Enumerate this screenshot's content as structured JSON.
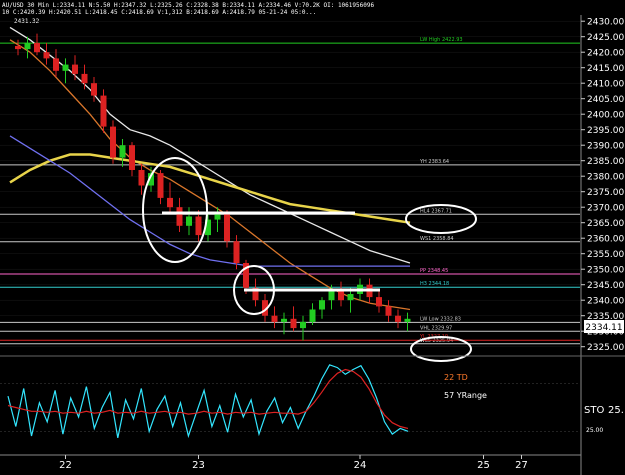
{
  "header": {
    "line1": "AU/USD 30 Min  L:2334.11  N:5.50  H:2347.32  L:2325.26  C:2328.38  B:2334.11  A:2334.46  V:70.2K  OI: 1061956096",
    "line2": "2431.32",
    "line3": "10  C:2420.39  H:2420.51  L:2418.45  C:2418.69  V:1,312  B:2418.69  A:2418.79  05-21-24  05:0..."
  },
  "colors": {
    "background": "#000000",
    "up_candle": "#22cc22",
    "down_candle": "#dd2222",
    "white_ma": "#e8e8e8",
    "yellow_ma": "#e8d44a",
    "orange_ma": "#d9762b",
    "purple_ma": "#7070f0",
    "lw_high": "#22cc22",
    "yh_line": "#c8c8c8",
    "pivot_pink": "#ff66cc",
    "r2_cyan": "#33cccc",
    "lw_low": "#c8c8c8",
    "yl_line": "#dd2222",
    "stoch_cyan": "#33e6ff",
    "stoch_red": "#dd2222",
    "axis_text": "#ffffff"
  },
  "chart_data": {
    "type": "candlestick",
    "ylim": [
      2322,
      2432
    ],
    "y_ticks": [
      2325,
      2330,
      2335,
      2340,
      2345,
      2350,
      2355,
      2360,
      2365,
      2370,
      2375,
      2380,
      2385,
      2390,
      2395,
      2400,
      2405,
      2410,
      2415,
      2420,
      2425,
      2430
    ],
    "y_tick_labels": [
      "2325.00",
      "2330.00",
      "2335.00",
      "2340.00",
      "2345.00",
      "2350.00",
      "2355.00",
      "2360.00",
      "2365.00",
      "2370.00",
      "2375.00",
      "2380.00",
      "2385.00",
      "2390.00",
      "2395.00",
      "2400.00",
      "2405.00",
      "2410.00",
      "2415.00",
      "2420.00",
      "2425.00",
      "2430.00"
    ],
    "last_price": "2334.11",
    "x_labels": [
      {
        "label": "22",
        "index": 5
      },
      {
        "label": "23",
        "index": 19
      },
      {
        "label": "24",
        "index": 36
      },
      {
        "label": "25",
        "index": 49
      },
      {
        "label": "27",
        "index": 53
      }
    ],
    "candles": [
      [
        2422,
        2424,
        2419,
        2421
      ],
      [
        2421,
        2425,
        2418,
        2423
      ],
      [
        2423,
        2426,
        2419,
        2420
      ],
      [
        2420,
        2423,
        2416,
        2418
      ],
      [
        2418,
        2421,
        2412,
        2414
      ],
      [
        2414,
        2418,
        2410,
        2416
      ],
      [
        2416,
        2419,
        2411,
        2413
      ],
      [
        2413,
        2416,
        2408,
        2410
      ],
      [
        2410,
        2412,
        2404,
        2406
      ],
      [
        2406,
        2408,
        2394,
        2396
      ],
      [
        2396,
        2398,
        2384,
        2386
      ],
      [
        2386,
        2392,
        2383,
        2390
      ],
      [
        2390,
        2391,
        2380,
        2382
      ],
      [
        2382,
        2384,
        2374,
        2377
      ],
      [
        2377,
        2383,
        2375,
        2381
      ],
      [
        2381,
        2382,
        2371,
        2373
      ],
      [
        2373,
        2378,
        2368,
        2370
      ],
      [
        2370,
        2373,
        2362,
        2364
      ],
      [
        2364,
        2370,
        2361,
        2367
      ],
      [
        2367,
        2369,
        2359,
        2361
      ],
      [
        2361,
        2368,
        2359,
        2366
      ],
      [
        2366,
        2370,
        2362,
        2368
      ],
      [
        2368,
        2369,
        2357,
        2359
      ],
      [
        2359,
        2361,
        2350,
        2352
      ],
      [
        2352,
        2353,
        2342,
        2344
      ],
      [
        2344,
        2347,
        2338,
        2340
      ],
      [
        2340,
        2342,
        2333,
        2335
      ],
      [
        2335,
        2338,
        2331,
        2333
      ],
      [
        2333,
        2336,
        2329,
        2334
      ],
      [
        2334,
        2338,
        2330,
        2331
      ],
      [
        2331,
        2335,
        2327,
        2333
      ],
      [
        2333,
        2339,
        2332,
        2337
      ],
      [
        2337,
        2341,
        2334,
        2340
      ],
      [
        2340,
        2345,
        2337,
        2343
      ],
      [
        2343,
        2346,
        2338,
        2340
      ],
      [
        2340,
        2344,
        2336,
        2342
      ],
      [
        2342,
        2347,
        2340,
        2345
      ],
      [
        2345,
        2347,
        2339,
        2341
      ],
      [
        2341,
        2343,
        2336,
        2338
      ],
      [
        2338,
        2340,
        2333,
        2335
      ],
      [
        2335,
        2337,
        2331,
        2333
      ],
      [
        2333,
        2336,
        2330,
        2334
      ]
    ],
    "moving_averages": [
      {
        "color_key": "white_ma",
        "values": [
          2428,
          2424,
          2419,
          2414,
          2408,
          2400,
          2395,
          2393,
          2390,
          2386,
          2382,
          2378,
          2374,
          2371,
          2368,
          2365,
          2362,
          2359,
          2356,
          2354,
          2352
        ]
      },
      {
        "color_key": "orange_ma",
        "values": [
          2424,
          2420,
          2414,
          2407,
          2400,
          2392,
          2386,
          2382,
          2379,
          2375,
          2371,
          2367,
          2362,
          2357,
          2352,
          2348,
          2344,
          2341,
          2339,
          2338,
          2337
        ]
      },
      {
        "color_key": "yellow_ma",
        "values": [
          2378,
          2382,
          2385,
          2387,
          2387,
          2386,
          2385,
          2384,
          2383,
          2381,
          2379,
          2377,
          2375,
          2373,
          2371,
          2370,
          2369,
          2368,
          2367,
          2366,
          2365
        ]
      },
      {
        "color_key": "purple_ma",
        "values": [
          2393,
          2389,
          2385,
          2381,
          2376,
          2371,
          2366,
          2362,
          2358,
          2355,
          2353,
          2352,
          2351,
          2351,
          2351,
          2351,
          2351,
          2351,
          2351,
          2351,
          2351
        ]
      }
    ],
    "levels": [
      {
        "label": "LW High  2422.93",
        "value": 2422.93,
        "color_key": "lw_high"
      },
      {
        "label": "YH  2383.64",
        "value": 2383.64,
        "color_key": "yh_line"
      },
      {
        "label": "HL4  2367.71",
        "value": 2367.71,
        "color_key": "yh_line"
      },
      {
        "label": "WS1  2358.84",
        "value": 2358.84,
        "color_key": "yh_line"
      },
      {
        "label": "PP  2348.45",
        "value": 2348.45,
        "color_key": "pivot_pink"
      },
      {
        "label": "H3  2344.18",
        "value": 2344.18,
        "color_key": "r2_cyan"
      },
      {
        "label": "LW Low  2332.83",
        "value": 2332.83,
        "color_key": "lw_low"
      },
      {
        "label": "VHL  2329.97",
        "value": 2329.97,
        "color_key": "yh_line"
      },
      {
        "label": "WL5  2325.94",
        "value": 2325.94,
        "color_key": "yh_line"
      },
      {
        "label": "YL  2327.10",
        "value": 2327.1,
        "color_key": "yl_line"
      }
    ],
    "stochastic": {
      "label": "STO",
      "value_label": "25.",
      "y_tick_label": "25.00",
      "k_values": [
        62,
        30,
        70,
        20,
        55,
        35,
        68,
        22,
        60,
        40,
        72,
        28,
        50,
        66,
        18,
        58,
        38,
        70,
        25,
        48,
        62,
        30,
        55,
        20,
        44,
        68,
        30,
        52,
        24,
        64,
        40,
        58,
        22,
        46,
        60,
        34,
        50,
        28,
        46,
        62,
        80,
        95,
        92,
        85,
        90,
        94,
        80,
        60,
        35,
        22,
        28,
        25
      ],
      "d_values": [
        52,
        50,
        48,
        46,
        46,
        45,
        46,
        44,
        45,
        44,
        46,
        44,
        45,
        47,
        44,
        45,
        44,
        46,
        44,
        45,
        46,
        44,
        45,
        43,
        44,
        46,
        44,
        45,
        43,
        45,
        44,
        45,
        43,
        44,
        45,
        44,
        44,
        43,
        46,
        55,
        66,
        78,
        86,
        90,
        88,
        82,
        70,
        55,
        42,
        34,
        30,
        28
      ]
    }
  },
  "annotations": {
    "td_label": "22 TD",
    "yrange_label": "57 YRange"
  }
}
